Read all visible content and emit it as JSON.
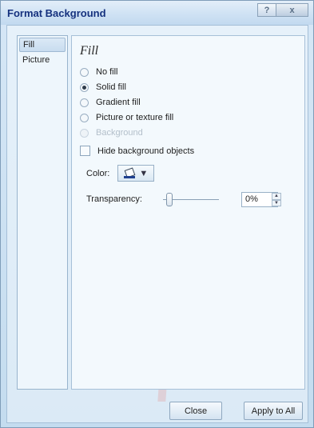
{
  "window": {
    "title": "Format Background",
    "help_icon": "?",
    "close_icon": "x"
  },
  "nav": {
    "items": [
      {
        "label": "Fill",
        "selected": true
      },
      {
        "label": "Picture",
        "selected": false
      }
    ]
  },
  "fill": {
    "section_title": "Fill",
    "no_fill": {
      "label": "No fill",
      "checked": false
    },
    "solid_fill": {
      "label": "Solid fill",
      "checked": true
    },
    "gradient_fill": {
      "label": "Gradient fill",
      "checked": false
    },
    "picture_fill": {
      "label": "Picture or texture fill",
      "checked": false
    },
    "background": {
      "label": "Background",
      "disabled": true
    },
    "hide_bg_objects": {
      "label": "Hide background objects",
      "checked": false
    },
    "color_label": "Color:",
    "color_dropdown_arrow": "▼",
    "transparency_label": "Transparency:",
    "transparency_value": "0%"
  },
  "buttons": {
    "close": "Close",
    "apply_all": "Apply to All"
  },
  "colors": {
    "title_text": "#15317e",
    "accent_border": "#7f9db9"
  }
}
